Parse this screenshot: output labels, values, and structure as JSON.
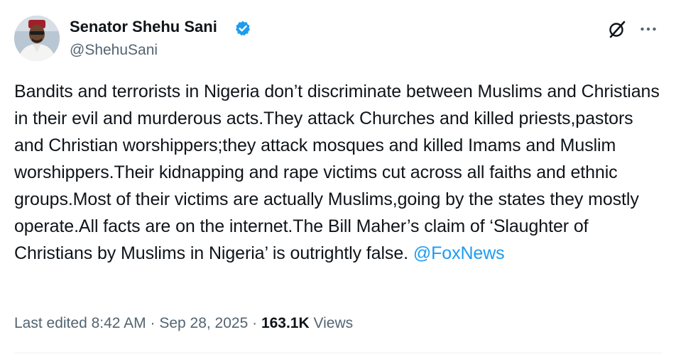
{
  "author": {
    "display_name": "Senator Shehu Sani",
    "handle": "@ShehuSani",
    "verified": true
  },
  "icons": {
    "verified": "verified-badge-icon",
    "grok": "grok-icon",
    "more": "more-icon"
  },
  "tweet": {
    "text": "Bandits and terrorists in Nigeria don’t discriminate between Muslims and Christians in their evil and murderous acts.They attack Churches and killed priests,pastors and Christian worshippers;they attack mosques and killed Imams and Muslim worshippers.Their kidnapping and rape victims cut across all faiths and ethnic groups.Most of their victims are actually Muslims,going by the states they mostly operate.All facts are on the internet.The Bill Maher’s claim of ‘Slaughter of Christians by Muslims in Nigeria’ is outrightly false. ",
    "mention": "@FoxNews"
  },
  "meta": {
    "edited_label": "Last edited 8:42 AM",
    "separator": " · ",
    "date": "Sep 28, 2025",
    "view_count": "163.1K",
    "views_label": "Views"
  },
  "colors": {
    "text": "#0f1419",
    "secondary": "#536471",
    "accent": "#1d9bf0"
  }
}
